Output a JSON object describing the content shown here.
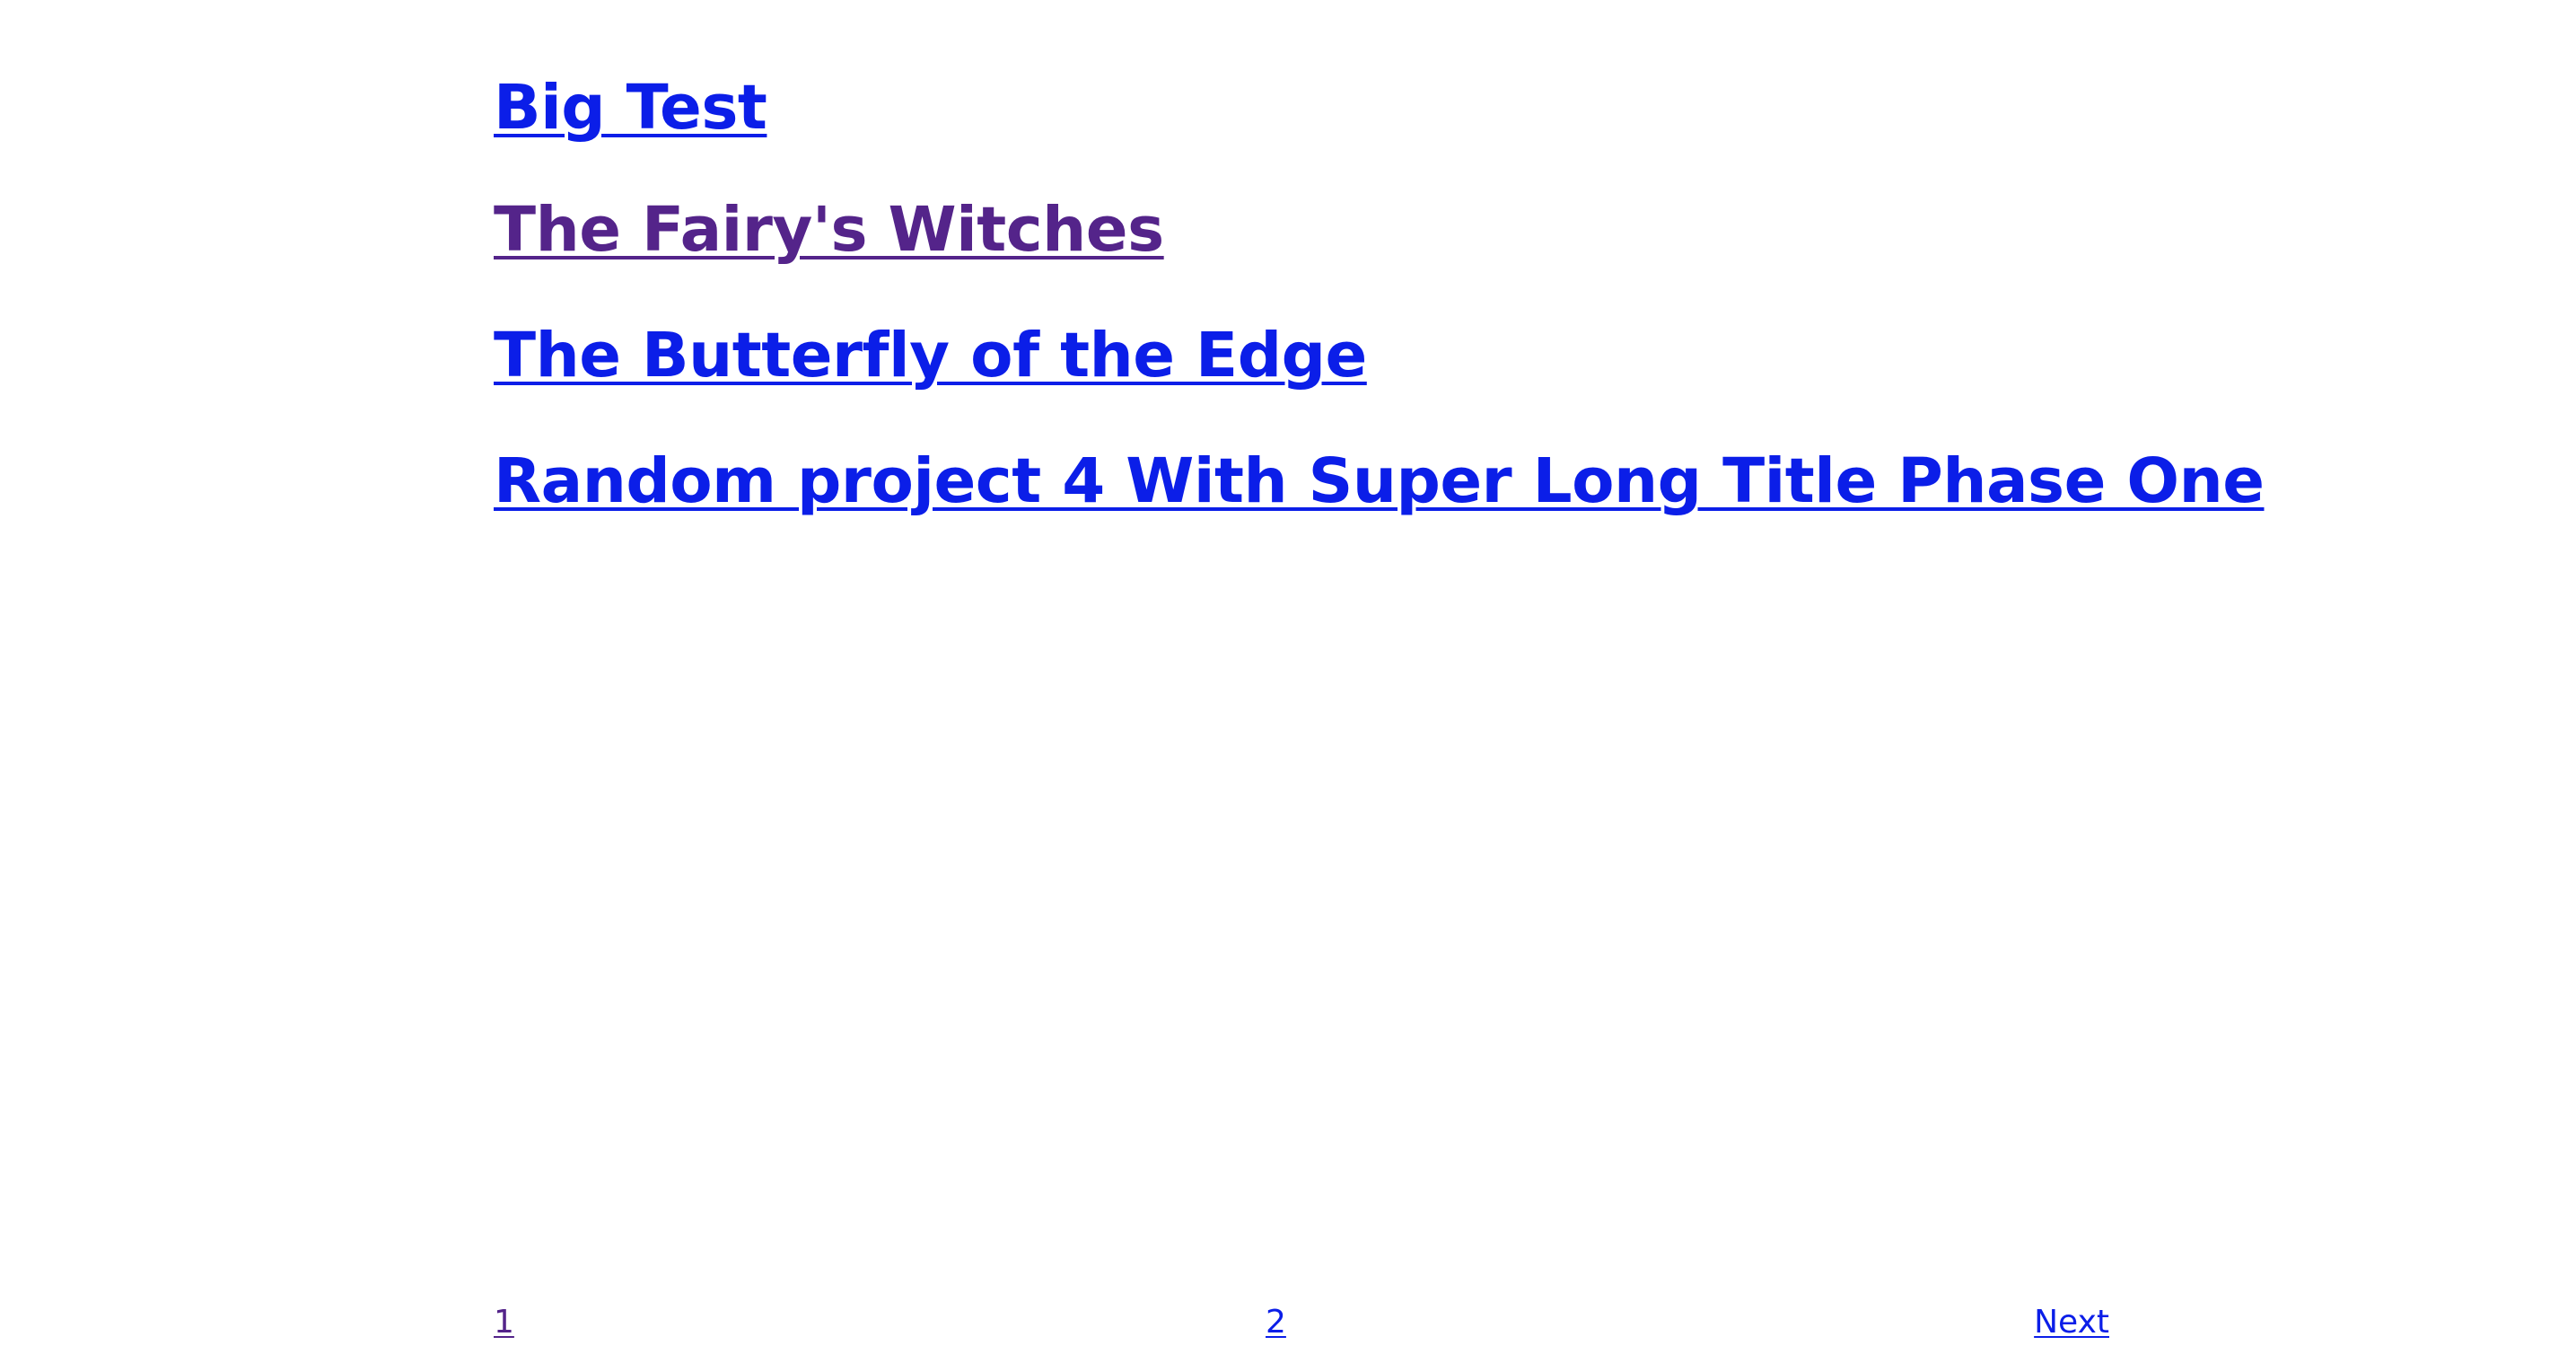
{
  "projects": [
    {
      "title": "Big Test",
      "visited": false
    },
    {
      "title": "The Fairy's Witches",
      "visited": true
    },
    {
      "title": "The Butterfly of the Edge",
      "visited": false
    },
    {
      "title": "Random project 4 With Super Long Title Phase One",
      "visited": false
    }
  ],
  "pagination": {
    "page_1": "1",
    "page_2": "2",
    "next": "Next"
  },
  "colors": {
    "link": "#0b1ee8",
    "visited_link": "#54248a",
    "background": "#ffffff"
  }
}
